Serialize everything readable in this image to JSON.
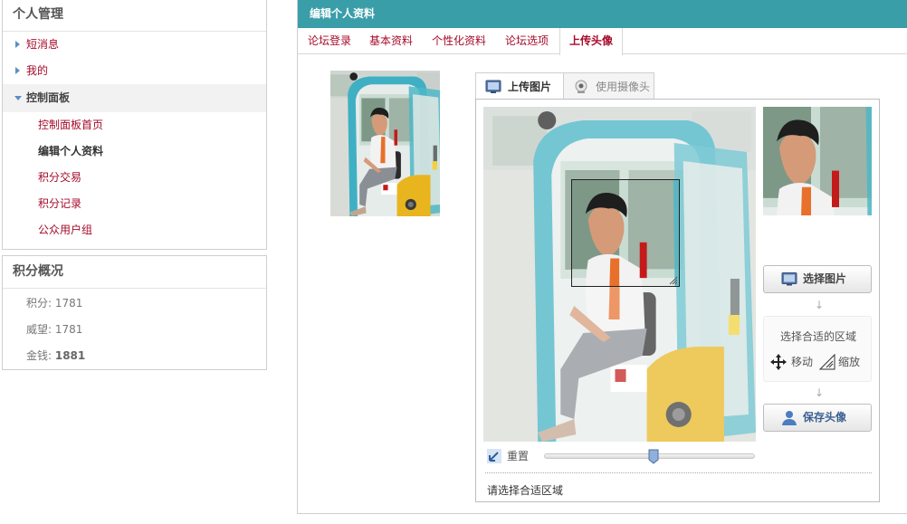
{
  "sidebar": {
    "title": "个人管理",
    "nav": [
      {
        "label": "短消息"
      },
      {
        "label": "我的"
      },
      {
        "label": "控制面板"
      }
    ],
    "sub_items": [
      {
        "label": "控制面板首页"
      },
      {
        "label": "编辑个人资料"
      },
      {
        "label": "积分交易"
      },
      {
        "label": "积分记录"
      },
      {
        "label": "公众用户组"
      }
    ],
    "points": {
      "title": "积分概况",
      "rows": [
        {
          "label": "积分: ",
          "value": "1781"
        },
        {
          "label": "威望: ",
          "value": "1781"
        },
        {
          "label": "金钱: ",
          "value": "1881"
        }
      ]
    }
  },
  "main": {
    "title": "编辑个人资料",
    "tabs": [
      {
        "label": "论坛登录"
      },
      {
        "label": "基本资料"
      },
      {
        "label": "个性化资料"
      },
      {
        "label": "论坛选项"
      },
      {
        "label": "上传头像"
      }
    ]
  },
  "upload": {
    "tabs": [
      {
        "label": "上传图片"
      },
      {
        "label": "使用摄像头"
      }
    ],
    "select_btn": "选择图片",
    "hint_title": "选择合适的区域",
    "move_label": "移动",
    "zoom_label": "缩放",
    "save_btn": "保存头像",
    "reset_label": "重置",
    "zoom_level": 0.52,
    "status": "请选择合适区域"
  },
  "colors": {
    "header": "#3a9ea9",
    "link": "#a50b2a",
    "cab": "#3fb0c3",
    "bucket": "#e8b51e"
  },
  "icons": [
    "image-icon",
    "webcam-icon",
    "move-icon",
    "resize-icon",
    "user-icon",
    "reset-icon",
    "arrow-down-icon"
  ]
}
